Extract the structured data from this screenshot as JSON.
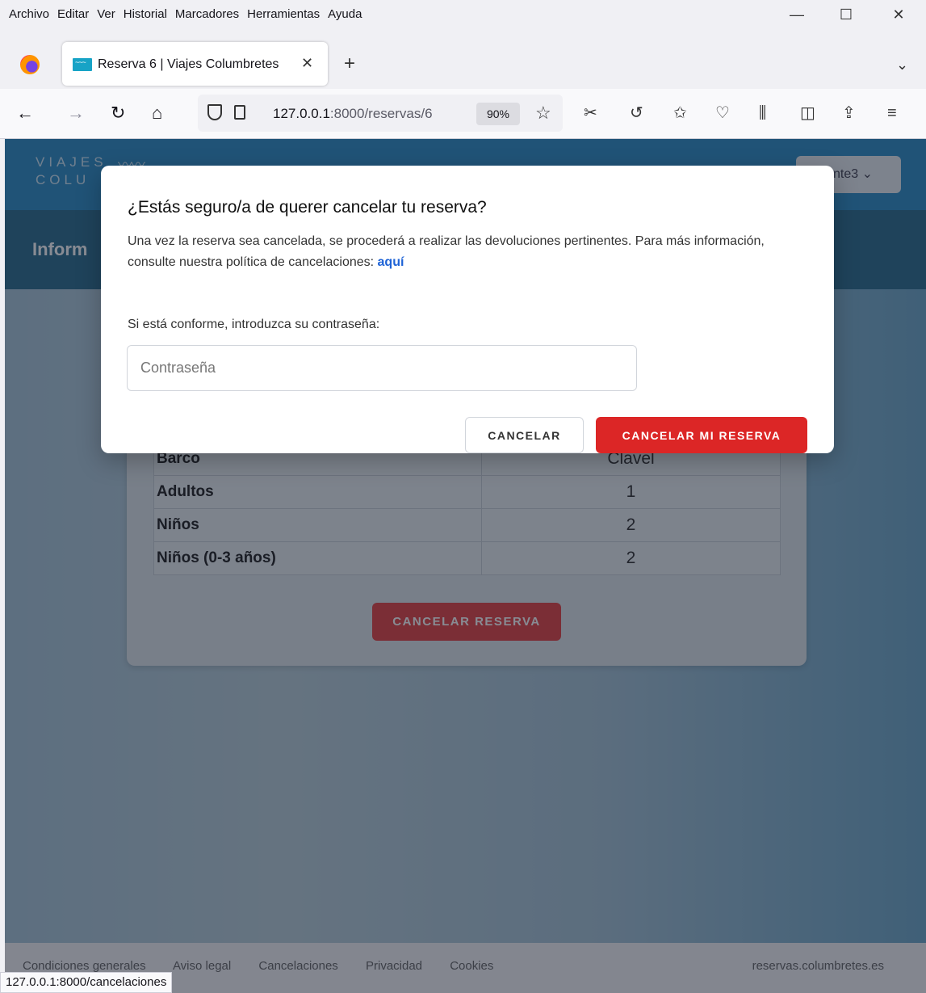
{
  "menubar": {
    "items": [
      "Archivo",
      "Editar",
      "Ver",
      "Historial",
      "Marcadores",
      "Herramientas",
      "Ayuda"
    ]
  },
  "window_controls": {
    "minimize": "—",
    "maximize": "☐",
    "close": "✕"
  },
  "tab": {
    "title": "Reserva 6 | Viajes Columbretes",
    "close": "✕",
    "new_tab": "+",
    "list_tabs": "⌄"
  },
  "navbar": {
    "url_host": "127.0.0.1",
    "url_rest": ":8000/reservas/6",
    "zoom": "90%"
  },
  "site": {
    "logo_line1": "VIAJES",
    "logo_line2": "COLU",
    "user_menu": "nte3 ⌄",
    "subheader_title": "Inform"
  },
  "reservation_table": [
    {
      "label": "Barco",
      "value": "Clavel"
    },
    {
      "label": "Adultos",
      "value": "1"
    },
    {
      "label": "Niños",
      "value": "2"
    },
    {
      "label": "Niños (0-3 años)",
      "value": "2"
    }
  ],
  "card_button": "CANCELAR RESERVA",
  "modal": {
    "title": "¿Estás seguro/a de querer cancelar tu reserva?",
    "text": "Una vez la reserva sea cancelada, se procederá a realizar las devoluciones pertinentes. Para más información, consulte nuestra política de cancelaciones: ",
    "link": "aquí",
    "prompt": "Si está conforme, introduzca su contraseña:",
    "password_placeholder": "Contraseña",
    "password_value": "",
    "cancel_button": "CANCELAR",
    "confirm_button": "CANCELAR MI RESERVA"
  },
  "footer": {
    "links": [
      "Condiciones generales",
      "Aviso legal",
      "Cancelaciones",
      "Privacidad",
      "Cookies"
    ],
    "site": "reservas.columbretes.es"
  },
  "status_url": "127.0.0.1:8000/cancelaciones",
  "colors": {
    "brand": "#2f8fc7",
    "danger": "#dc2626",
    "link": "#1e63d6"
  }
}
